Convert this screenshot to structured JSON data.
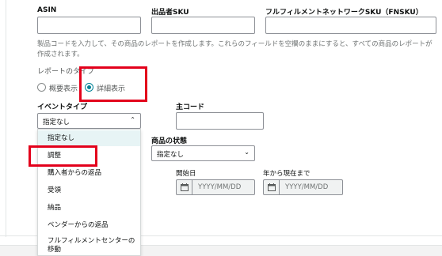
{
  "fields": {
    "asin_label": "ASIN",
    "sku_label": "出品者SKU",
    "fnsku_label": "フルフィルメントネットワークSKU（FNSKU）",
    "help_text": "製品コードを入力して、その商品のレポートを作成します。これらのフィールドを空欄のままにすると、すべての商品のレポートが作成されます。"
  },
  "report_type": {
    "label": "レポートのタイプ",
    "options": [
      "概要表示",
      "詳細表示"
    ],
    "selected": "詳細表示"
  },
  "event_type": {
    "label": "イベントタイプ",
    "selected_value": "指定なし",
    "options": [
      "指定なし",
      "調整",
      "購入者からの返品",
      "受領",
      "納品",
      "ベンダーからの返品",
      "フルフィルメントセンターの移動"
    ]
  },
  "main_code": {
    "label": "主コード"
  },
  "product_condition": {
    "label": "商品の状態",
    "selected_value": "指定なし"
  },
  "dates": {
    "start_label": "開始日",
    "end_label": "年から現在まで",
    "start_placeholder": "YYYY/MM/DD",
    "end_placeholder": "YYYY/MM/DD"
  },
  "colors": {
    "accent": "#008296",
    "highlight": "#e3001b",
    "selected_bg": "#e7f4f5"
  },
  "icons": {
    "chevron": "chevron-down-icon",
    "calendar": "calendar-icon"
  }
}
